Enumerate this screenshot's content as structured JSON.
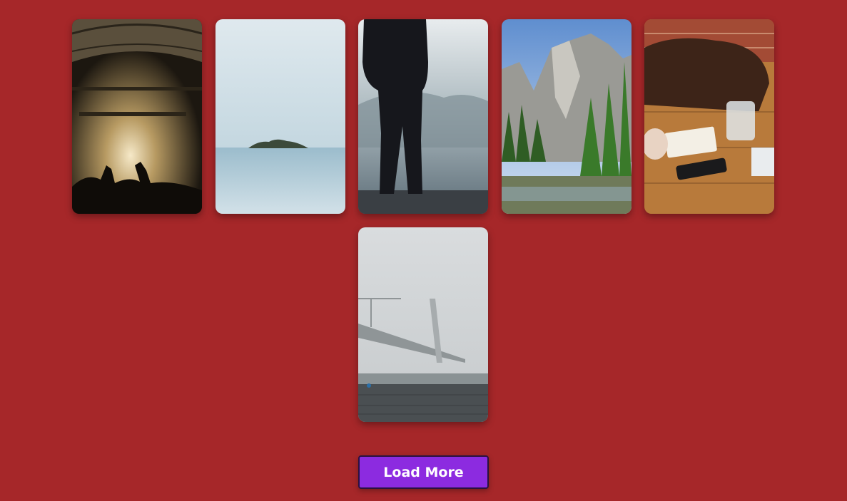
{
  "colors": {
    "page_background": "#a62729",
    "button_background": "#8c2be0",
    "button_text": "#ffffff"
  },
  "gallery": {
    "images": [
      {
        "subject": "concert-crowd-photo"
      },
      {
        "subject": "island-seascape-photo"
      },
      {
        "subject": "person-on-foggy-pier-photo"
      },
      {
        "subject": "mountain-forest-valley-photo"
      },
      {
        "subject": "desk-notebook-phone-photo"
      },
      {
        "subject": "foggy-bridge-photo"
      }
    ]
  },
  "actions": {
    "load_more_label": "Load More"
  }
}
